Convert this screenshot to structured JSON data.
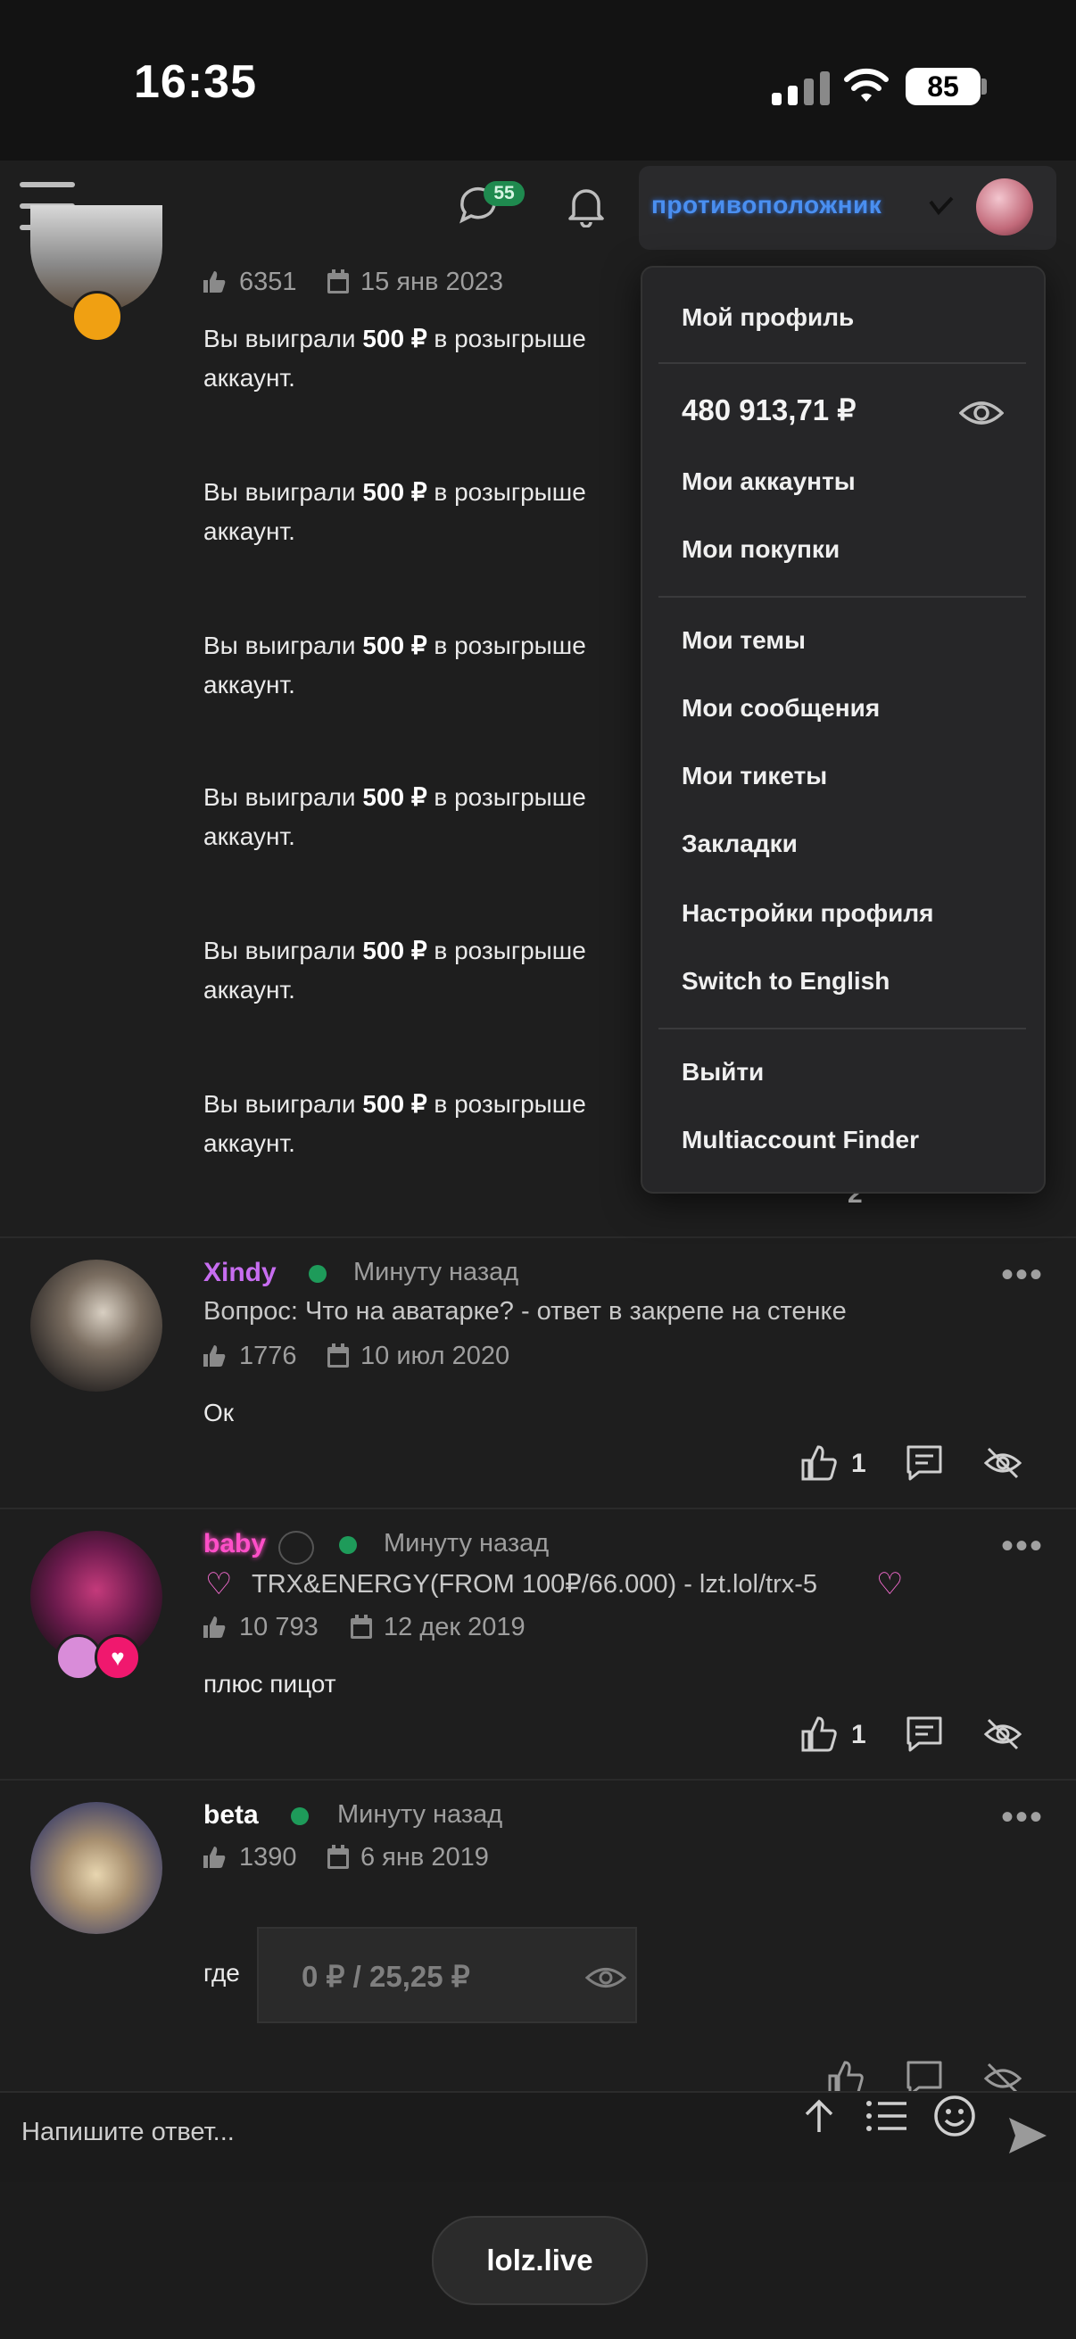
{
  "status_bar": {
    "time": "16:35",
    "battery": "85"
  },
  "header": {
    "username": "противоположник",
    "messages_badge": "55"
  },
  "dropdown": {
    "my_profile": "Мой профиль",
    "balance": "480 913,71 ₽",
    "my_accounts": "Мои аккаунты",
    "my_purchases": "Мои покупки",
    "my_threads": "Мои темы",
    "my_messages": "Мои сообщения",
    "my_tickets": "Мои тикеты",
    "bookmarks": "Закладки",
    "profile_settings": "Настройки профиля",
    "switch_language": "Switch to English",
    "logout": "Выйти",
    "multiaccount": "Multiaccount Finder"
  },
  "post1": {
    "likes": "6351",
    "date": "15 янв 2023",
    "lines": [
      {
        "pre": "Вы выиграли ",
        "amount": "500 ₽",
        "post": " в розыгрыше",
        "second": "аккаунт."
      },
      {
        "pre": "Вы выиграли ",
        "amount": "500 ₽",
        "post": " в розыгрыше",
        "second": "аккаунт."
      },
      {
        "pre": "Вы выиграли ",
        "amount": "500 ₽",
        "post": " в розыгрыше",
        "second": "аккаунт."
      },
      {
        "pre": "Вы выиграли ",
        "amount": "500 ₽",
        "post": " в розыгрыше",
        "second": "аккаунт."
      },
      {
        "pre": "Вы выиграли ",
        "amount": "500 ₽",
        "post": " в розыгрыше",
        "second": "аккаунт."
      },
      {
        "pre": "Вы выиграли ",
        "amount": "500 ₽",
        "post": " в розыгрыше",
        "second": "аккаунт."
      }
    ],
    "reaction_count": "2"
  },
  "post2": {
    "username": "Xindy",
    "username_color": "#c76df0",
    "time": "Минуту назад",
    "status": "Вопрос: Что на аватарке? - ответ в закрепе на стенке",
    "likes": "1776",
    "date": "10 июл 2020",
    "text": "Ок",
    "reaction_count": "1"
  },
  "post3": {
    "username": "baby",
    "username_color": "#ff4fc8",
    "time": "Минуту назад",
    "status": "TRX&ENERGY(FROM 100₽/66.000) - lzt.lol/trx-5",
    "likes": "10 793",
    "date": "12 дек 2019",
    "text": "плюс пицот",
    "reaction_count": "1"
  },
  "post4": {
    "username": "beta",
    "username_color": "#ffffff",
    "time": "Минуту назад",
    "likes": "1390",
    "date": "6 янв 2019",
    "text": "где",
    "image_text": "0 ₽  /  25,25 ₽"
  },
  "reply": {
    "placeholder": "Напишите ответ..."
  },
  "footer": {
    "url": "lolz.live"
  },
  "colors": {
    "online": "#1e9b5a",
    "accent_blue": "#4a8ff0",
    "badge_green": "#1f8a4f"
  }
}
